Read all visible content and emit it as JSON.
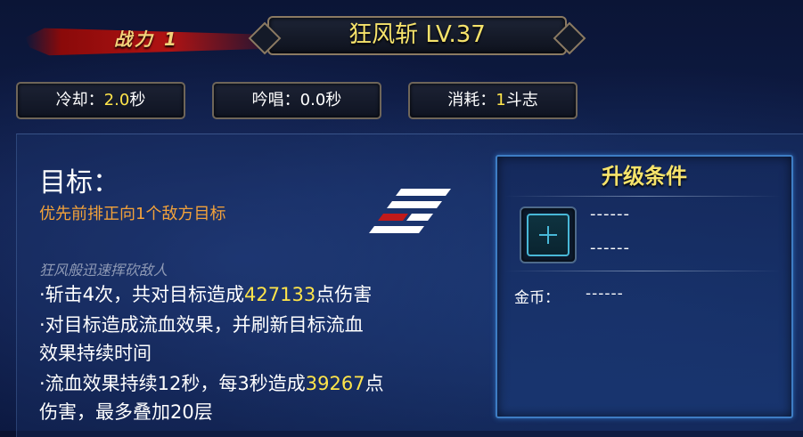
{
  "header": {
    "power_label": "战力 1",
    "skill_title": "狂风斩 LV.37"
  },
  "stats": [
    {
      "label": "冷却：",
      "value": "2.0",
      "suffix": "秒"
    },
    {
      "label": "吟唱：",
      "value": "0.0秒",
      "suffix": ""
    },
    {
      "label": "消耗：",
      "value": "1",
      "suffix": "斗志"
    }
  ],
  "target": {
    "heading": "目标：",
    "description": "优先前排正向1个敌方目标"
  },
  "description": {
    "flavor": "狂风般迅速挥砍敌人",
    "line1_prefix": "·斩击4次，共对目标造成",
    "line1_value": "427133",
    "line1_suffix": "点伤害",
    "line2": "·对目标造成流血效果，并刷新目标流血",
    "line3": "效果持续时间",
    "line4_prefix": "·流血效果持续12秒，每3秒造成",
    "line4_value": "39267",
    "line4_suffix": "点",
    "line5": "伤害，最多叠加20层"
  },
  "upgrade": {
    "title": "升级条件",
    "requirement_line1": "------",
    "requirement_line2": "------",
    "gold_label": "金币：",
    "gold_value": "------"
  },
  "colors": {
    "highlight": "#ffe54a",
    "target_text": "#f3a23a",
    "title_gold": "#f6e36b",
    "power_banner": "#b01313",
    "frame_blue": "#3e7dc4"
  },
  "icons": {
    "skill_pattern": "stacked-stripes-icon",
    "add_slot": "plus-icon"
  }
}
